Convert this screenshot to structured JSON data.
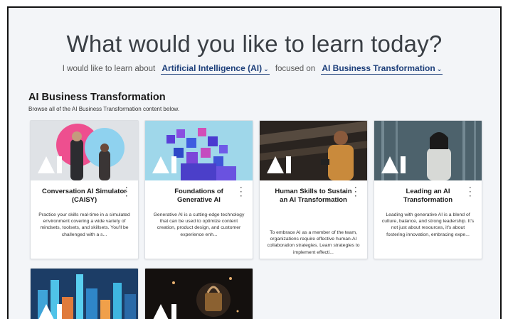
{
  "header": {
    "title": "What would you like to learn today?",
    "prefix": "I would like to learn about",
    "topic": "Artificial Intelligence (AI)",
    "focus_label": "focused on",
    "focus": "AI Business Transformation"
  },
  "section": {
    "title": "AI Business Transformation",
    "subtitle": "Browse all of the AI Business Transformation content below."
  },
  "cards": [
    {
      "title": "Conversation AI Simulator (CAISY)",
      "description": "Practice your skills real-time in a simulated environment covering a wide variety of mindsets, toolsets, and skillsets. You'll be challenged with a s..."
    },
    {
      "title": "Foundations of Generative AI",
      "description": "Generative AI is a cutting-edge technology that can be used to optimize content creation, product design, and customer experience enh..."
    },
    {
      "title": "Human Skills to Sustain an AI Transformation",
      "description": "To embrace AI as a member of the team, organizations require effective human-AI collaboration strategies. Learn strategies to implement effecti..."
    },
    {
      "title": "Leading an AI Transformation",
      "description": "Leading with generative AI is a blend of culture, balance, and strong leadership. It's not just about resources, it's about fostering innovation, embracing expe..."
    }
  ],
  "icons": {
    "chevron": "chevron-down-icon",
    "menu": "kebab-menu-icon",
    "logo": "ai-logo-icon"
  },
  "colors": {
    "accent": "#1d3f7a",
    "background": "#f3f5f8"
  }
}
